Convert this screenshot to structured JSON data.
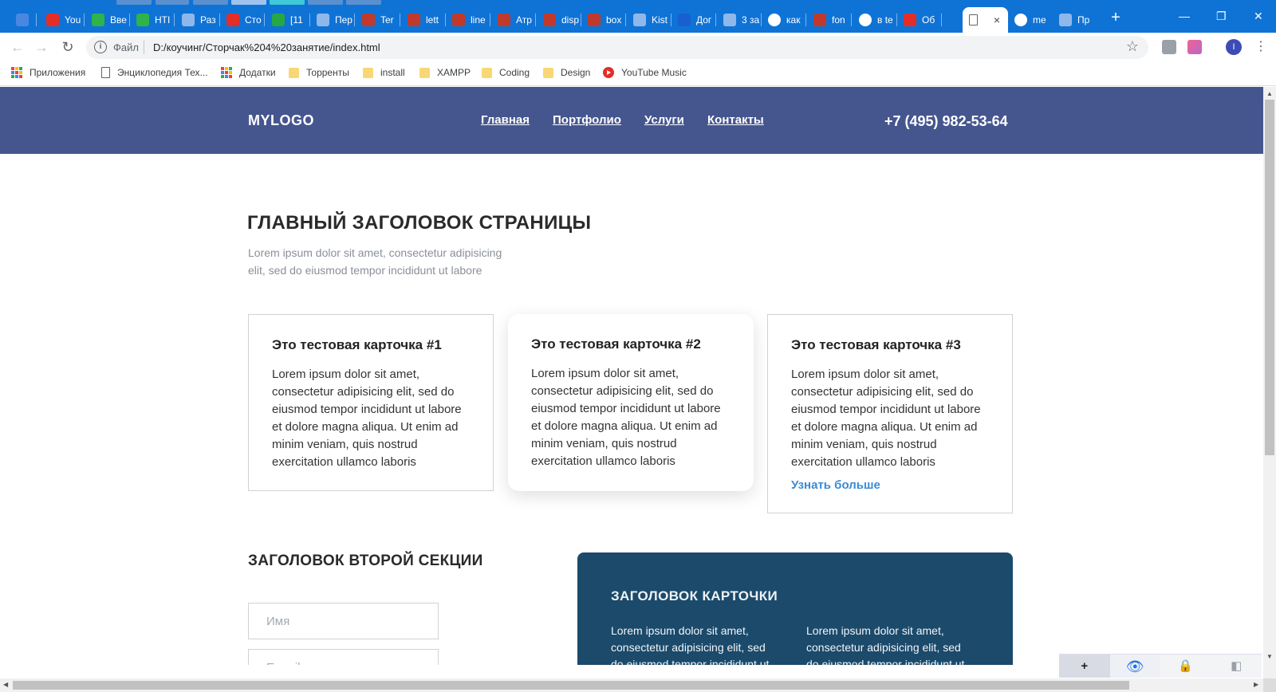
{
  "browser": {
    "tabs": [
      {
        "label": "",
        "color": "#4a87e0"
      },
      {
        "label": "You",
        "color": "#e52d27"
      },
      {
        "label": "Вве",
        "color": "#2fb34a"
      },
      {
        "label": "HTI",
        "color": "#2fb34a"
      },
      {
        "label": "Раз",
        "color": "#8fb8ea"
      },
      {
        "label": "Сто",
        "color": "#e52d27"
      },
      {
        "label": "[11",
        "color": "#28a745"
      },
      {
        "label": "Пер",
        "color": "#8fb8ea"
      },
      {
        "label": "Ter",
        "color": "#c0392b"
      },
      {
        "label": "lett",
        "color": "#c0392b"
      },
      {
        "label": "line",
        "color": "#c0392b"
      },
      {
        "label": "Атр",
        "color": "#c0392b"
      },
      {
        "label": "disp",
        "color": "#c0392b"
      },
      {
        "label": "box",
        "color": "#c0392b"
      },
      {
        "label": "Kist",
        "color": "#8fb8ea"
      },
      {
        "label": "Дог",
        "color": "#1a5fd0"
      },
      {
        "label": "3 за",
        "color": "#8fb8ea"
      },
      {
        "label": "как",
        "color": "#ffffff"
      },
      {
        "label": "fon",
        "color": "#c0392b"
      },
      {
        "label": "в te",
        "color": "#ffffff"
      },
      {
        "label": "Об",
        "color": "#e52d27"
      }
    ],
    "active_tab": {
      "label": "",
      "close": "×"
    },
    "after_tabs": [
      {
        "label": "me",
        "color": "#ffffff"
      },
      {
        "label": "Пр",
        "color": "#8fb8ea"
      }
    ],
    "new_tab": "+",
    "window_controls": {
      "minimize": "—",
      "restore": "❐",
      "close": "✕"
    },
    "address": {
      "scheme": "Файл",
      "url": "D:/коучинг/Сторчак%204%20занятие/index.html"
    },
    "profile_initial": "I",
    "bookmarks": [
      {
        "label": "Приложения",
        "icon": "apps-icon"
      },
      {
        "label": "Энциклопедия Тех...",
        "icon": "page-icon"
      },
      {
        "label": "Додатки",
        "icon": "apps-icon"
      },
      {
        "label": "Торренты",
        "icon": "folder-icon"
      },
      {
        "label": "install",
        "icon": "folder-icon"
      },
      {
        "label": "XAMPP",
        "icon": "folder-icon"
      },
      {
        "label": "Coding",
        "icon": "folder-icon"
      },
      {
        "label": "Design",
        "icon": "folder-icon"
      },
      {
        "label": "YouTube Music",
        "icon": "youtube-music-icon"
      }
    ]
  },
  "site": {
    "logo": "MYLOGO",
    "nav": [
      "Главная",
      "Портфолио",
      "Услуги",
      "Контакты"
    ],
    "phone": "+7 (495) 982-53-64",
    "header_color": "#45568f",
    "title": "ГЛАВНЫЙ ЗАГОЛОВОК СТРАНИЦЫ",
    "lead": "Lorem ipsum dolor sit amet, consectetur adipisicing elit, sed do eiusmod tempor incididunt ut labore",
    "cards": [
      {
        "title": "Это тестовая карточка #1",
        "text": "Lorem ipsum dolor sit amet, consectetur adipisicing elit, sed do eiusmod tempor incididunt ut labore et dolore magna aliqua. Ut enim ad minim veniam, quis nostrud exercitation ullamco laboris"
      },
      {
        "title": "Это тестовая карточка #2",
        "text": "Lorem ipsum dolor sit amet, consectetur adipisicing elit, sed do eiusmod tempor incididunt ut labore et dolore magna aliqua. Ut enim ad minim veniam, quis nostrud exercitation ullamco laboris"
      },
      {
        "title": "Это тестовая карточка #3",
        "text": "Lorem ipsum dolor sit amet, consectetur adipisicing elit, sed do eiusmod tempor incididunt ut labore et dolore magna aliqua. Ut enim ad minim veniam, quis nostrud exercitation ullamco laboris",
        "link": "Узнать больше"
      }
    ],
    "section2_title": "ЗАГОЛОВОК ВТОРОЙ СЕКЦИИ",
    "form": {
      "name_placeholder": "Имя",
      "email_placeholder": "E-mail"
    },
    "dark_card": {
      "title": "ЗАГОЛОВОК КАРТОЧКИ",
      "col1": "Lorem ipsum dolor sit amet, consectetur adipisicing elit, sed do eiusmod tempor incididunt ut labore et dolore magna aliqua.",
      "col2": "Lorem ipsum dolor sit amet, consectetur adipisicing elit, sed do eiusmod tempor incididunt ut labore et dolore magna aliqua.",
      "color": "#1b4a6b"
    },
    "link_color": "#3a8bd4"
  },
  "devtools_bar": {
    "add": "+",
    "eye": "👁",
    "lock": "🔒",
    "panel": "◧"
  }
}
